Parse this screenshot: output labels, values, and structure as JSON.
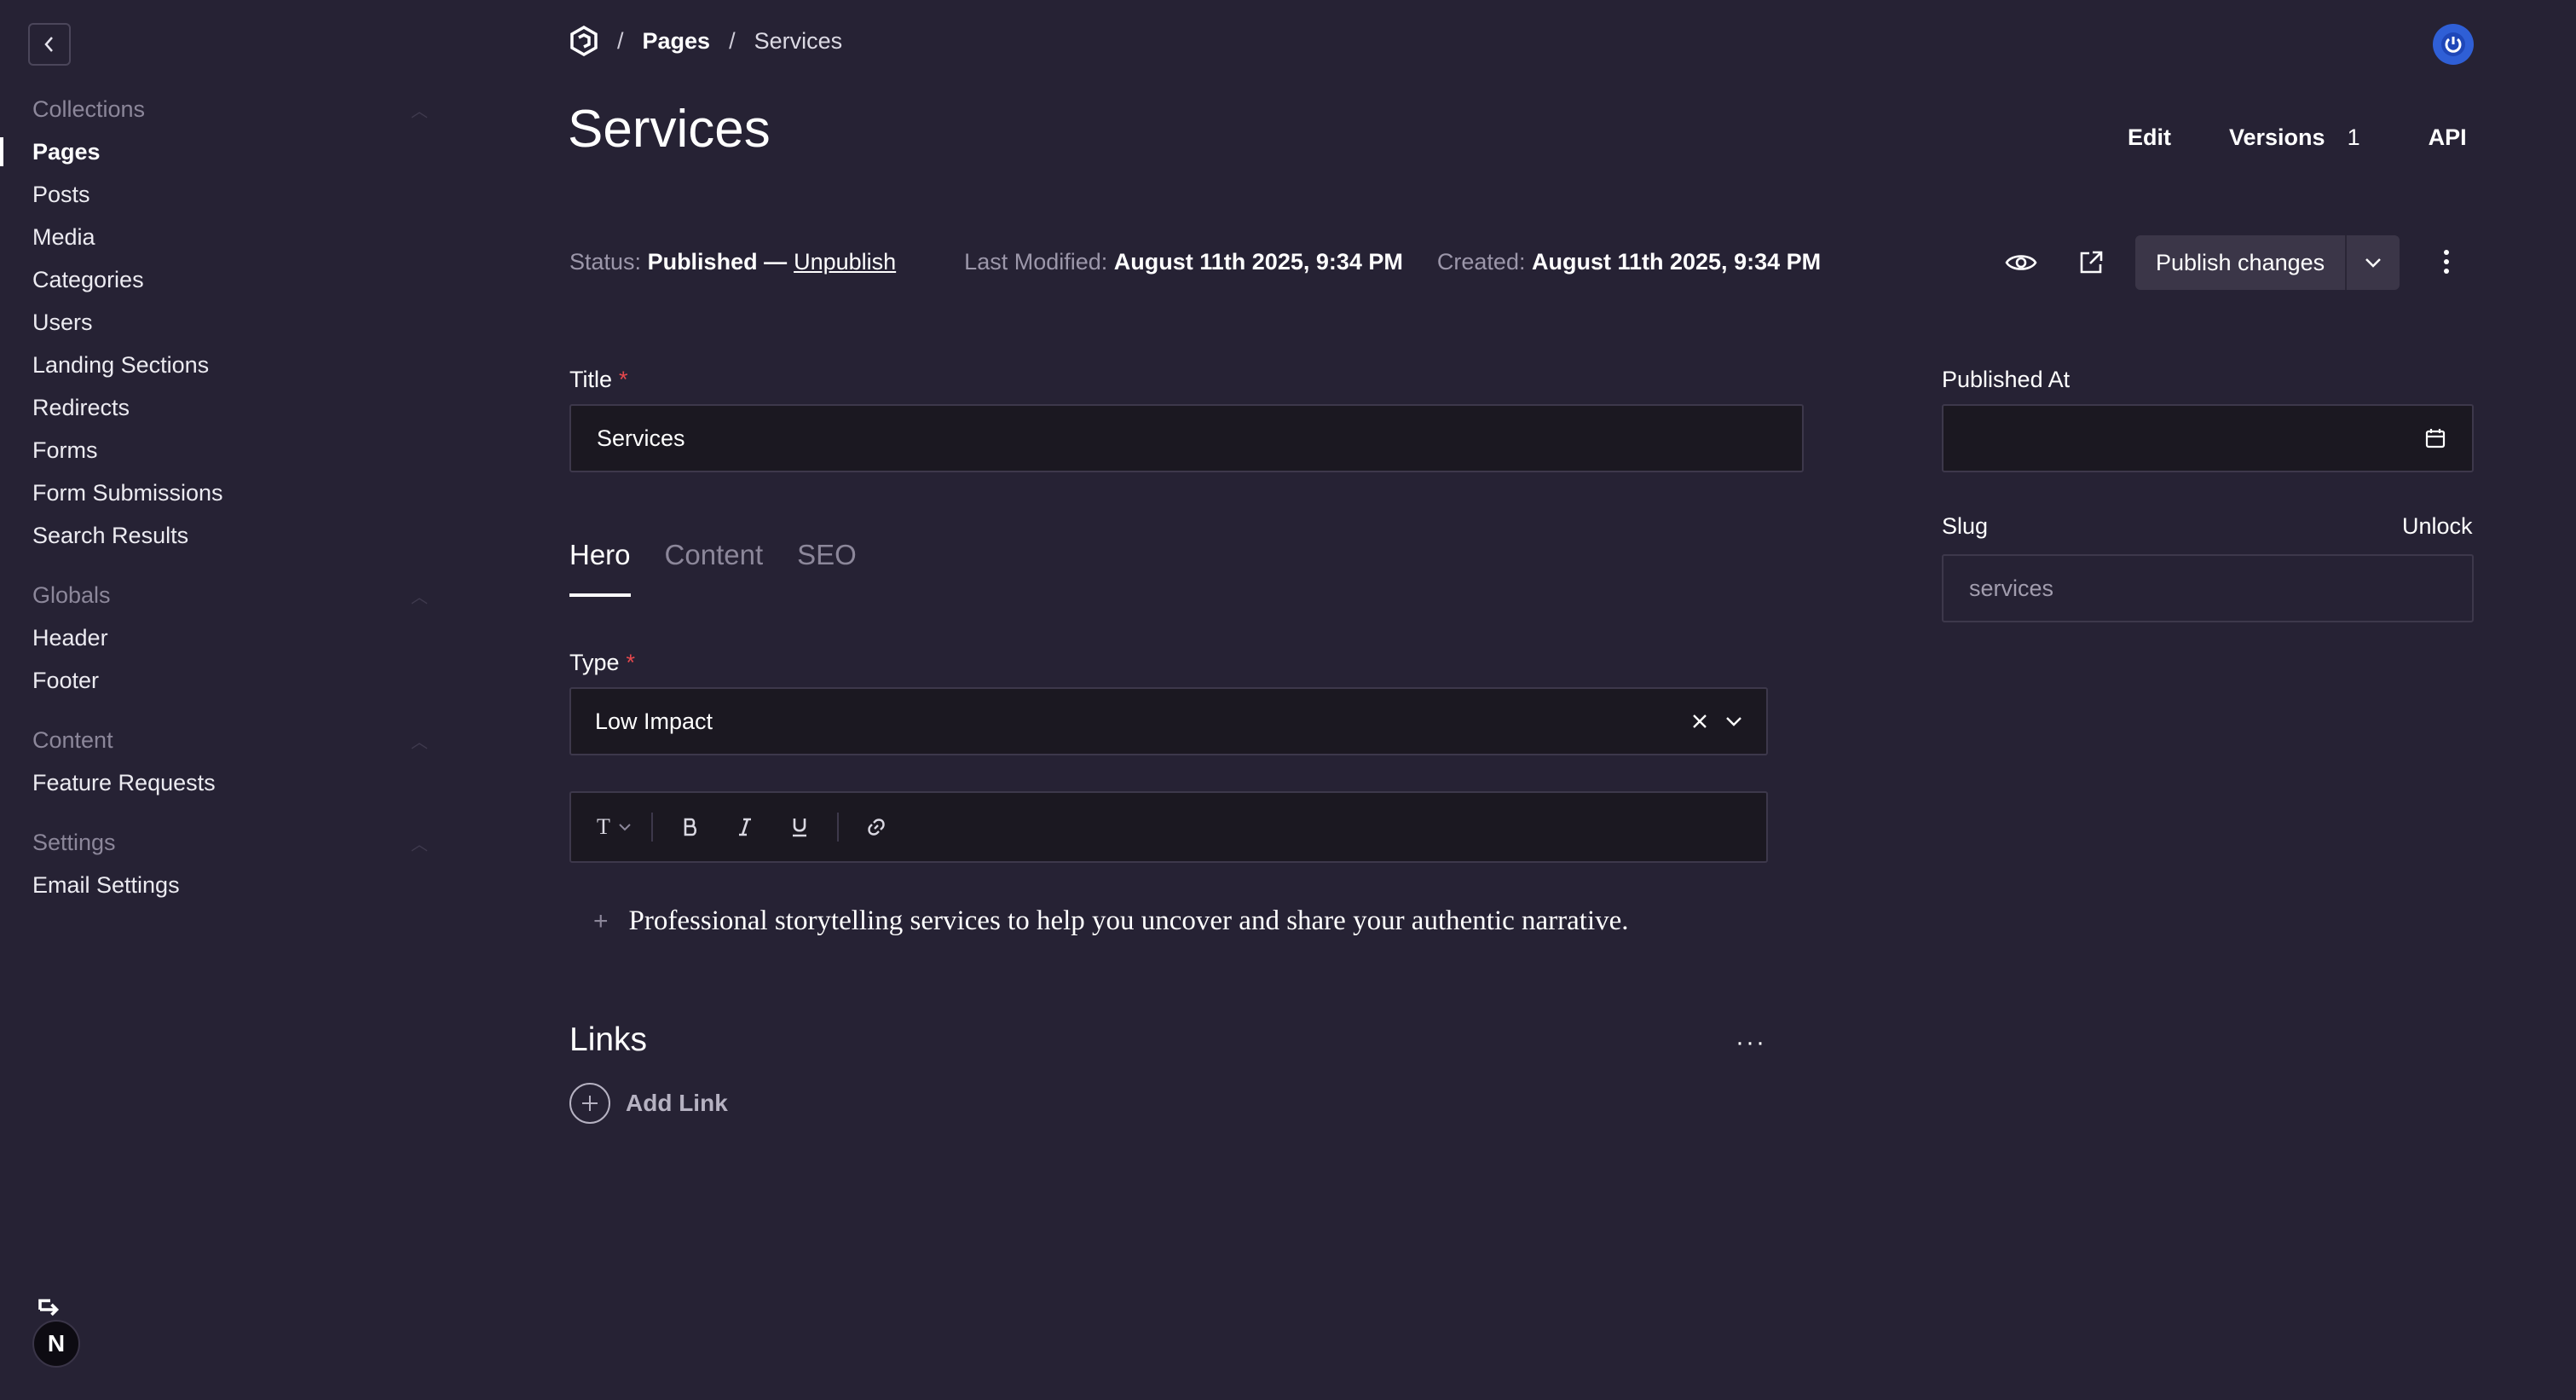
{
  "sidebar": {
    "groups": [
      {
        "title": "Collections",
        "items": [
          "Pages",
          "Posts",
          "Media",
          "Categories",
          "Users",
          "Landing Sections",
          "Redirects",
          "Forms",
          "Form Submissions",
          "Search Results"
        ]
      },
      {
        "title": "Globals",
        "items": [
          "Header",
          "Footer"
        ]
      },
      {
        "title": "Content",
        "items": [
          "Feature Requests"
        ]
      },
      {
        "title": "Settings",
        "items": [
          "Email Settings"
        ]
      }
    ],
    "active_item": "Pages",
    "account_badge": "N"
  },
  "breadcrumb": {
    "sep": "/",
    "pages": "Pages",
    "current": "Services"
  },
  "page": {
    "title": "Services"
  },
  "doc_tabs": {
    "edit": "Edit",
    "versions": "Versions",
    "versions_count": "1",
    "api": "API"
  },
  "status": {
    "status_label": "Status:",
    "status_value": "Published —",
    "unpublish": "Unpublish",
    "modified_label": "Last Modified:",
    "modified_value": "August 11th 2025, 9:34 PM",
    "created_label": "Created:",
    "created_value": "August 11th 2025, 9:34 PM"
  },
  "actions": {
    "publish": "Publish changes"
  },
  "fields": {
    "title_label": "Title",
    "title_value": "Services",
    "published_at_label": "Published At",
    "published_at_value": "",
    "slug_label": "Slug",
    "slug_unlock": "Unlock",
    "slug_value": "services",
    "type_label": "Type",
    "type_value": "Low Impact",
    "required_mark": "*"
  },
  "tabs": [
    "Hero",
    "Content",
    "SEO"
  ],
  "active_tab": "Hero",
  "richtext": {
    "text": "Professional storytelling services to help you uncover and share your authentic narrative.",
    "block_type": "T"
  },
  "links": {
    "title": "Links",
    "add": "Add Link",
    "more": "···"
  },
  "colors": {
    "background": "#262234",
    "input_bg": "#1b1821",
    "border": "#3d384b",
    "required": "#e5484d",
    "avatar": "#2f5fd6"
  }
}
